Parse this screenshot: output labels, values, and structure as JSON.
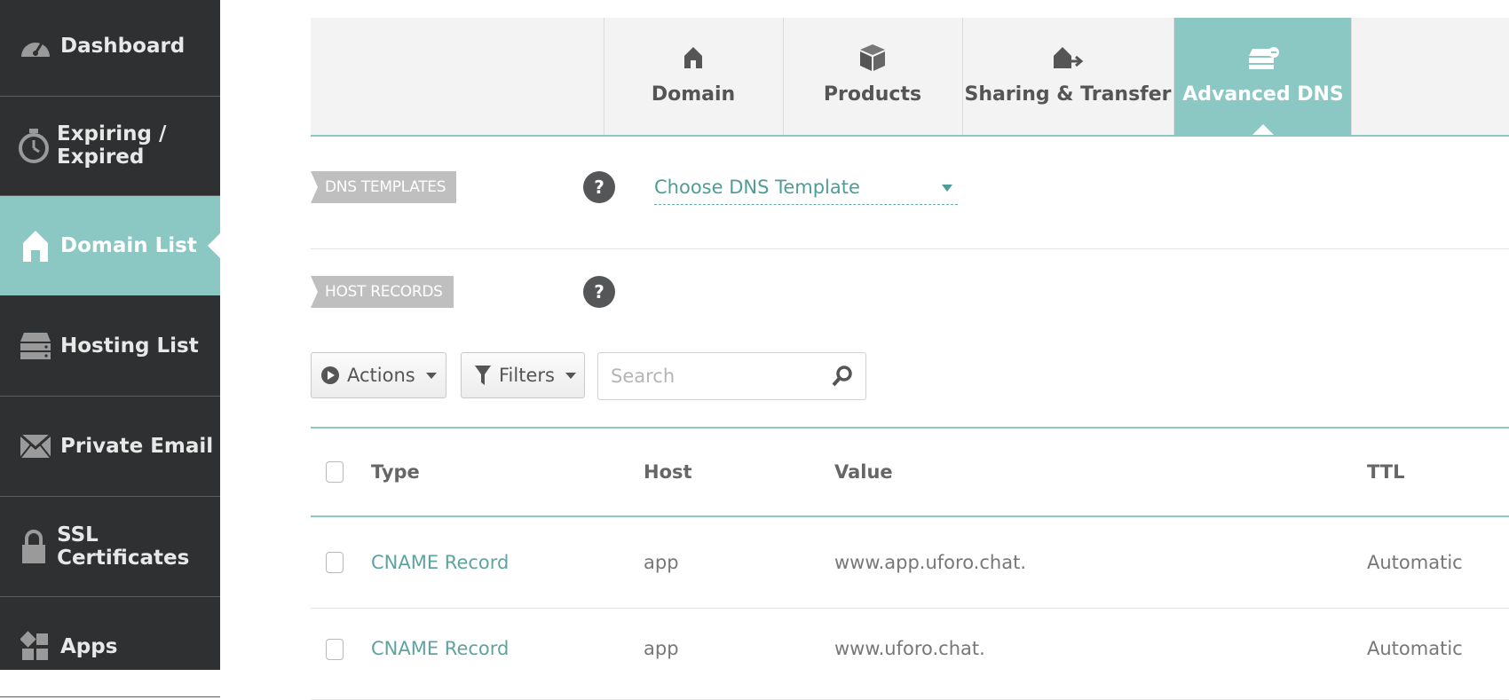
{
  "sidebar": {
    "items": [
      {
        "label": "Dashboard",
        "icon": "gauge-icon",
        "active": false
      },
      {
        "label": "Expiring / Expired",
        "icon": "stopwatch-icon",
        "active": false
      },
      {
        "label": "Domain List",
        "icon": "house-icon",
        "active": true
      },
      {
        "label": "Hosting List",
        "icon": "server-icon",
        "active": false
      },
      {
        "label": "Private Email",
        "icon": "envelope-icon",
        "active": false
      },
      {
        "label": "SSL Certificates",
        "icon": "lock-icon",
        "active": false
      },
      {
        "label": "Apps",
        "icon": "apps-icon",
        "active": false
      }
    ]
  },
  "tabs": [
    {
      "label": "Domain",
      "icon": "house-icon"
    },
    {
      "label": "Products",
      "icon": "box-icon"
    },
    {
      "label": "Sharing & Transfer",
      "icon": "house-arrow-icon"
    },
    {
      "label": "Advanced DNS",
      "icon": "dns-server-icon",
      "active": true
    }
  ],
  "dns_templates": {
    "label": "DNS TEMPLATES",
    "help": "?",
    "select_value": "Choose DNS Template"
  },
  "host_records": {
    "label": "HOST RECORDS",
    "help": "?"
  },
  "toolbar": {
    "actions_label": "Actions",
    "filters_label": "Filters",
    "search_placeholder": "Search"
  },
  "table": {
    "headers": [
      "Type",
      "Host",
      "Value",
      "TTL"
    ],
    "rows": [
      {
        "type": "CNAME Record",
        "host": "app",
        "value": "www.app.uforo.chat.",
        "ttl": "Automatic"
      },
      {
        "type": "CNAME Record",
        "host": "app",
        "value": "www.uforo.chat.",
        "ttl": "Automatic"
      }
    ]
  },
  "colors": {
    "accent": "#8bc7c3",
    "sidebar_bg": "#2f3031",
    "link": "#5fa39f"
  }
}
